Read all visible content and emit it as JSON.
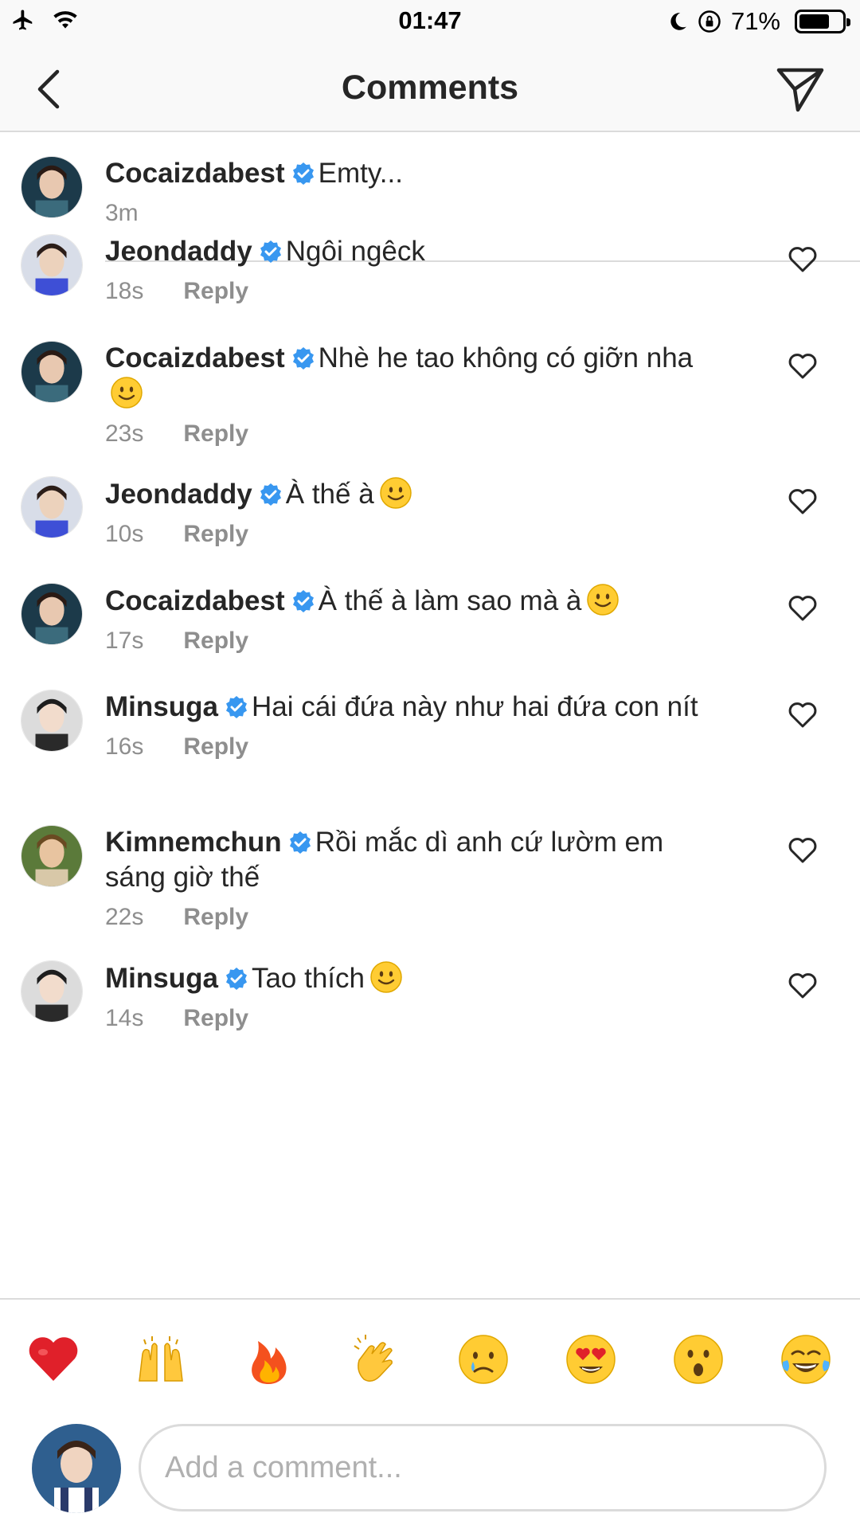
{
  "status_bar": {
    "time": "01:47",
    "battery_percent_text": "71%",
    "battery_level": 0.71,
    "icons": [
      "airplane-icon",
      "wifi-icon",
      "moon-icon",
      "rotation-lock-icon",
      "battery-icon"
    ]
  },
  "header": {
    "title": "Comments",
    "back_icon": "chevron-left-icon",
    "share_icon": "paper-plane-icon"
  },
  "caption": {
    "username": "Cocaizdabest",
    "text": "Emty...",
    "time": "3m"
  },
  "comments": [
    {
      "username": "Jeondaddy",
      "text": "Ngôi ngêck",
      "emoji": "",
      "time": "18s",
      "reply": "Reply"
    },
    {
      "username": "Cocaizdabest",
      "text": "Nhè he tao không có giỡn nha",
      "emoji": "slightly-smiling-face",
      "time": "23s",
      "reply": "Reply"
    },
    {
      "username": "Jeondaddy",
      "text": "À thế à",
      "emoji": "slightly-smiling-face",
      "time": "10s",
      "reply": "Reply"
    },
    {
      "username": "Cocaizdabest",
      "text": "À thế à làm sao mà à",
      "emoji": "slightly-smiling-face",
      "time": "17s",
      "reply": "Reply"
    },
    {
      "username": "Minsuga",
      "text": "Hai cái đứa này như hai đứa con nít",
      "emoji": "",
      "time": "16s",
      "reply": "Reply"
    },
    {
      "username": "Kimnemchun",
      "text": "Rồi mắc dì anh cứ lườm em sáng giờ thế",
      "emoji": "",
      "time": "22s",
      "reply": "Reply"
    },
    {
      "username": "Minsuga",
      "text": "Tao thích",
      "emoji": "slightly-smiling-face",
      "time": "14s",
      "reply": "Reply"
    }
  ],
  "quick_emojis": [
    "red-heart",
    "raising-hands",
    "fire",
    "clapping-hands",
    "crying-face",
    "heart-eyes-face",
    "astonished-face",
    "tears-of-joy-face"
  ],
  "composer": {
    "placeholder": "Add a comment..."
  },
  "colors": {
    "verified": "#3897f0",
    "meta_text": "#8e8e8e",
    "divider": "#dbdbdb",
    "header_bg": "#f9f9f9"
  }
}
